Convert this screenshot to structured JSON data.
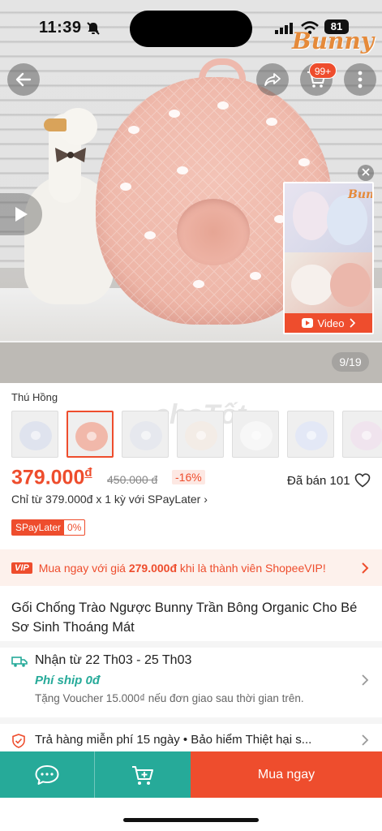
{
  "status_bar": {
    "time": "11:39",
    "battery": "81"
  },
  "brand": {
    "logo_text": "Bunny"
  },
  "header": {
    "cart_badge": "99+"
  },
  "gallery": {
    "counter": "9/19",
    "video_label": "Video",
    "video_logo": "Bunny",
    "watermark": "choTốt"
  },
  "variation": {
    "label": "Thú Hồng",
    "options": [
      {
        "name": "variant-1",
        "color": "#dfe3ee",
        "selected": false
      },
      {
        "name": "variant-2",
        "color": "#f1b8aa",
        "selected": true
      },
      {
        "name": "variant-3",
        "color": "#e6e8ee",
        "selected": false
      },
      {
        "name": "variant-4",
        "color": "#f3ece6",
        "selected": false
      },
      {
        "name": "variant-5",
        "color": "#f7f7f7",
        "selected": false
      },
      {
        "name": "variant-6",
        "color": "#e3e8f6",
        "selected": false
      },
      {
        "name": "variant-7",
        "color": "#f0e4ee",
        "selected": false
      }
    ]
  },
  "price": {
    "current": "379.000",
    "currency": "đ",
    "original": "450.000 đ",
    "discount": "-16%",
    "sold": "Đã bán 101",
    "installment": "Chỉ từ 379.000đ x 1 kỳ với SPayLater ›",
    "spay_label": "SPayLater",
    "spay_rate": "0%"
  },
  "vip": {
    "tag": "VIP",
    "text_before": "Mua ngay với giá ",
    "price": "279.000đ",
    "text_after": " khi là thành viên ShopeeVIP!"
  },
  "product": {
    "title": "Gối Chống Trào Ngược Bunny Trần Bông Organic Cho Bé Sơ Sinh Thoáng Mát"
  },
  "shipping": {
    "date": "Nhận từ 22 Th03 - 25 Th03",
    "fee": "Phí ship 0đ",
    "voucher": "Tặng Voucher 15.000₫ nếu đơn giao sau thời gian trên."
  },
  "guarantee": {
    "text": "Trả hàng miễn phí 15 ngày  •  Bảo hiểm Thiệt hại s..."
  },
  "bottom_bar": {
    "buy_label": "Mua ngay"
  },
  "colors": {
    "accent": "#ee4d2d",
    "teal": "#26aa99"
  }
}
